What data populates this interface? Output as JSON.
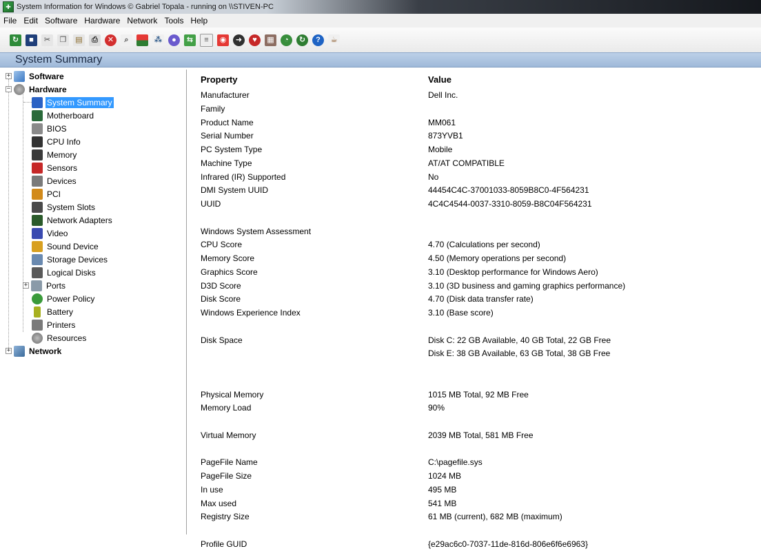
{
  "window": {
    "title": "System Information for Windows  © Gabriel Topala - running on \\\\STIVEN-PC"
  },
  "menu": [
    "File",
    "Edit",
    "Software",
    "Hardware",
    "Network",
    "Tools",
    "Help"
  ],
  "toolbar": {
    "icons": [
      "refresh-icon",
      "save-icon",
      "cut-icon",
      "copy-icon",
      "paste-icon",
      "print-icon",
      "stop-icon",
      "search-icon",
      "color-icon",
      "chart-icon",
      "plugin-icon",
      "sync-icon",
      "document-icon",
      "record-icon",
      "navigate-icon",
      "shield-icon",
      "tools-icon",
      "stats-icon",
      "update-icon",
      "help-icon",
      "coffee-icon"
    ]
  },
  "header": {
    "title": "System Summary"
  },
  "tree": {
    "software": "Software",
    "hardware": "Hardware",
    "network": "Network",
    "hardware_items": [
      {
        "label": "System Summary",
        "icon": "monitor-icon",
        "color": "#2b62c4"
      },
      {
        "label": "Motherboard",
        "icon": "motherboard-icon",
        "color": "#2a6a3a"
      },
      {
        "label": "BIOS",
        "icon": "chip-icon",
        "color": "#8a8a8a"
      },
      {
        "label": "CPU Info",
        "icon": "cpu-icon",
        "color": "#333333"
      },
      {
        "label": "Memory",
        "icon": "memory-icon",
        "color": "#3a3a3a"
      },
      {
        "label": "Sensors",
        "icon": "thermometer-icon",
        "color": "#c62828"
      },
      {
        "label": "Devices",
        "icon": "devices-icon",
        "color": "#7a7a7a"
      },
      {
        "label": "PCI",
        "icon": "pci-icon",
        "color": "#d28a1a"
      },
      {
        "label": "System Slots",
        "icon": "slot-icon",
        "color": "#4a4a4a"
      },
      {
        "label": "Network Adapters",
        "icon": "network-adapter-icon",
        "color": "#2a5a2a"
      },
      {
        "label": "Video",
        "icon": "video-icon",
        "color": "#3a4ab0"
      },
      {
        "label": "Sound Device",
        "icon": "sound-icon",
        "color": "#d8a020"
      },
      {
        "label": "Storage Devices",
        "icon": "storage-icon",
        "color": "#6a8ab0"
      },
      {
        "label": "Logical Disks",
        "icon": "disk-icon",
        "color": "#5a5a5a"
      },
      {
        "label": "Ports",
        "icon": "ports-icon",
        "color": "#8a9aa8"
      },
      {
        "label": "Power Policy",
        "icon": "power-icon",
        "color": "#3a9a3a"
      },
      {
        "label": "Battery",
        "icon": "battery-icon",
        "color": "#a8b020"
      },
      {
        "label": "Printers",
        "icon": "printer-icon",
        "color": "#7a7a7a"
      },
      {
        "label": "Resources",
        "icon": "resources-icon",
        "color": "#6a6a6a"
      }
    ]
  },
  "table": {
    "col_property": "Property",
    "col_value": "Value",
    "rows": [
      {
        "p": "Manufacturer",
        "v": "Dell Inc."
      },
      {
        "p": "Family",
        "v": ""
      },
      {
        "p": "Product Name",
        "v": "MM061"
      },
      {
        "p": "Serial Number",
        "v": "873YVB1"
      },
      {
        "p": "PC System Type",
        "v": "Mobile"
      },
      {
        "p": "Machine Type",
        "v": "AT/AT COMPATIBLE"
      },
      {
        "p": "Infrared (IR) Supported",
        "v": "No"
      },
      {
        "p": "DMI System UUID",
        "v": "44454C4C-37001033-8059B8C0-4F564231"
      },
      {
        "p": "UUID",
        "v": "4C4C4544-0037-3310-8059-B8C04F564231"
      },
      {
        "p": "",
        "v": ""
      },
      {
        "p": "Windows System Assessment",
        "v": ""
      },
      {
        "p": "CPU Score",
        "v": "4.70 (Calculations per second)"
      },
      {
        "p": "Memory Score",
        "v": "4.50 (Memory operations per second)"
      },
      {
        "p": "Graphics Score",
        "v": "3.10 (Desktop performance for Windows Aero)"
      },
      {
        "p": "D3D Score",
        "v": "3.10 (3D business and gaming graphics performance)"
      },
      {
        "p": "Disk Score",
        "v": "4.70 (Disk data transfer rate)"
      },
      {
        "p": "Windows Experience Index",
        "v": "3.10 (Base score)"
      },
      {
        "p": "",
        "v": ""
      },
      {
        "p": "Disk Space",
        "v": "Disk C: 22 GB Available, 40 GB Total, 22 GB Free"
      },
      {
        "p": "",
        "v": "Disk E: 38 GB Available, 63 GB Total, 38 GB Free"
      },
      {
        "p": "",
        "v": ""
      },
      {
        "p": "",
        "v": ""
      },
      {
        "p": "Physical Memory",
        "v": "1015 MB Total, 92 MB Free"
      },
      {
        "p": "Memory Load",
        "v": "90%"
      },
      {
        "p": "",
        "v": ""
      },
      {
        "p": "Virtual Memory",
        "v": "2039 MB Total, 581 MB Free"
      },
      {
        "p": "",
        "v": ""
      },
      {
        "p": "PageFile Name",
        "v": "C:\\pagefile.sys"
      },
      {
        "p": "PageFile Size",
        "v": "1024 MB"
      },
      {
        "p": "In use",
        "v": "495 MB"
      },
      {
        "p": "Max used",
        "v": "541 MB"
      },
      {
        "p": "Registry Size",
        "v": "61 MB (current), 682 MB (maximum)"
      },
      {
        "p": "",
        "v": ""
      },
      {
        "p": "Profile GUID",
        "v": "{e29ac6c0-7037-11de-816d-806e6f6e6963}"
      }
    ]
  }
}
